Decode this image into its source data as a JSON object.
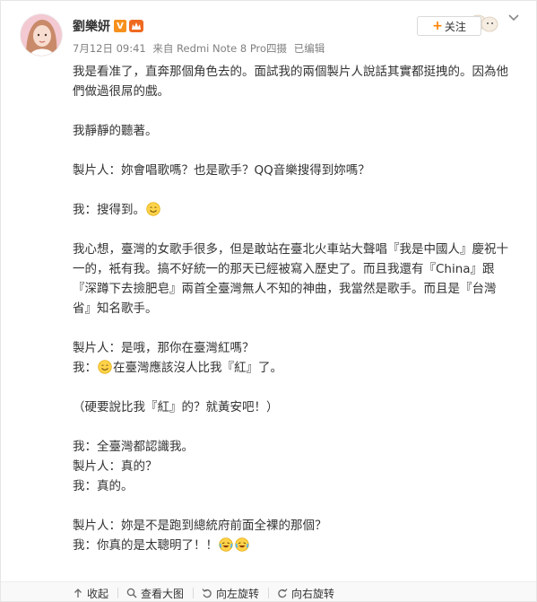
{
  "post": {
    "author": "劉樂妍",
    "verified_badge": "V",
    "member_badge": "會員",
    "timestamp": "7月12日 09:41",
    "source": "来自 Redmi Note 8 Pro四摄",
    "edited": "已编辑",
    "follow_label": "关注",
    "paragraphs": [
      {
        "lines": [
          "我是看准了，直奔那個角色去的。面試我的兩個製片人說話其實都挺拽的。因為他們做過很屌的戲。"
        ]
      },
      {
        "lines": [
          "我靜靜的聽著。"
        ]
      },
      {
        "lines": [
          "製片人：妳會唱歌嗎？也是歌手？QQ音樂搜得到妳嗎？"
        ]
      },
      {
        "lines": [
          "我：搜得到。"
        ],
        "emoji": "smile"
      },
      {
        "lines": [
          "我心想，臺灣的女歌手很多，但是敢站在臺北火車站大聲唱『我是中國人』慶祝十一的，衹有我。搞不好統一的那天已經被寫入歷史了。而且我還有『China』跟『深蹲下去撿肥皂』兩首全臺灣無人不知的神曲，我當然是歌手。而且是『台灣省』知名歌手。"
        ]
      },
      {
        "lines": [
          "製片人：是哦，那你在臺灣紅嗎？"
        ],
        "second": {
          "prefix": "我：",
          "emoji": "smile",
          "text": "在臺灣應該沒人比我『紅』了。"
        }
      },
      {
        "lines": [
          "（硬要說比我『紅』的？就黃安吧！）"
        ]
      },
      {
        "lines": [
          "我：全臺灣都認識我。",
          "製片人：真的？",
          "我：真的。"
        ]
      },
      {
        "lines": [
          "製片人：妳是不是跑到總統府前面全裸的那個？"
        ],
        "second": {
          "prefix": "我：",
          "text": "你真的是太聰明了！！",
          "emoji_after": "laugh-cry"
        }
      }
    ]
  },
  "toolbar": {
    "collapse": "收起",
    "view_large": "查看大图",
    "rotate_left": "向左旋转",
    "rotate_right": "向右旋转"
  },
  "icons": {
    "emoji_smile": "smile-emoji",
    "emoji_laugh_cry": "laugh-cry-emoji",
    "chevron": "chevron-down-icon",
    "follow_plus": "plus-icon"
  },
  "colors": {
    "accent": "#ff8200",
    "verified": "#f7911e",
    "text": "#333333",
    "meta": "#808080"
  }
}
